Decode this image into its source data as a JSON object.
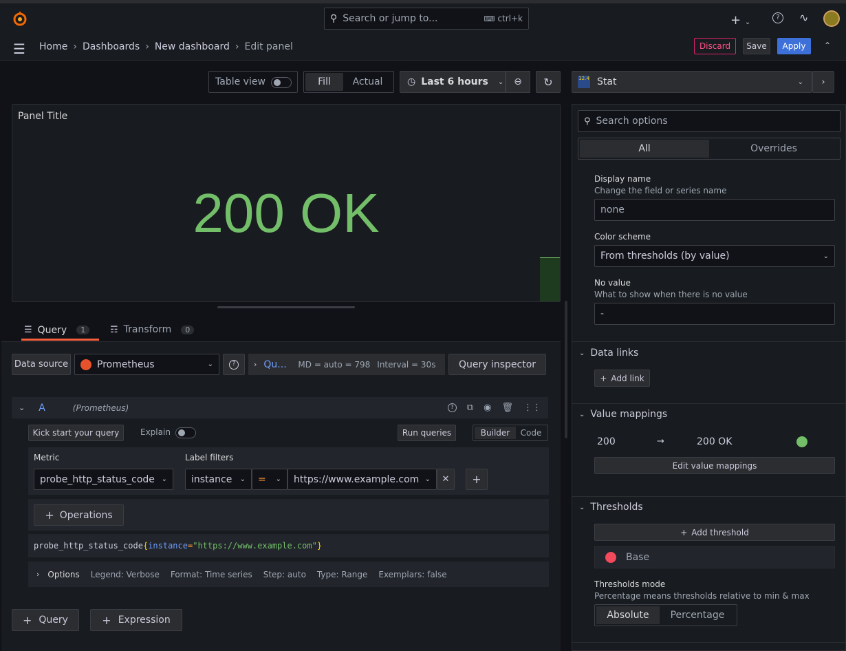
{
  "topbar": {
    "search_placeholder": "Search or jump to...",
    "shortcut": "ctrl+k"
  },
  "breadcrumb": [
    "Home",
    "Dashboards",
    "New dashboard",
    "Edit panel"
  ],
  "actions": {
    "discard": "Discard",
    "save": "Save",
    "apply": "Apply"
  },
  "toolbar": {
    "table_view": "Table view",
    "fill": "Fill",
    "actual": "Actual",
    "time_range": "Last 6 hours"
  },
  "panel": {
    "title": "Panel Title",
    "value": "200 OK",
    "value_color": "#73bf69"
  },
  "tabs": {
    "query_label": "Query",
    "query_count": "1",
    "transform_label": "Transform",
    "transform_count": "0"
  },
  "datasource": {
    "label": "Data source",
    "name": "Prometheus",
    "query_options_short": "Qu...",
    "md": "MD = auto = 798",
    "interval": "Interval = 30s",
    "inspector": "Query inspector"
  },
  "query": {
    "ref": "A",
    "ds": "(Prometheus)",
    "kickstart": "Kick start your query",
    "explain": "Explain",
    "run": "Run queries",
    "builder": "Builder",
    "code": "Code",
    "metric_label": "Metric",
    "metric_value": "probe_http_status_code",
    "label_filters_label": "Label filters",
    "label_key": "instance",
    "label_op": "=",
    "label_value": "https://www.example.com",
    "operations": "Operations",
    "expr_metric": "probe_http_status_code",
    "expr_open": "{",
    "expr_label": "instance",
    "expr_eq": "=",
    "expr_value": "\"https://www.example.com\"",
    "expr_close": "}",
    "options_label": "Options",
    "opt_legend": "Legend: Verbose",
    "opt_format": "Format: Time series",
    "opt_step": "Step: auto",
    "opt_type": "Type: Range",
    "opt_exemplars": "Exemplars: false"
  },
  "bottom": {
    "add_query": "Query",
    "add_expression": "Expression"
  },
  "viz": {
    "name": "Stat",
    "icon_badge": "12.4"
  },
  "options": {
    "search_placeholder": "Search options",
    "tab_all": "All",
    "tab_overrides": "Overrides",
    "display_name_label": "Display name",
    "display_name_desc": "Change the field or series name",
    "display_name_placeholder": "none",
    "color_scheme_label": "Color scheme",
    "color_scheme_value": "From thresholds (by value)",
    "no_value_label": "No value",
    "no_value_desc": "What to show when there is no value",
    "no_value_placeholder": "-",
    "data_links": "Data links",
    "add_link": "Add link",
    "value_mappings": "Value mappings",
    "mapping_from": "200",
    "mapping_to": "200 OK",
    "mapping_color": "#73bf69",
    "edit_mappings": "Edit value mappings",
    "thresholds": "Thresholds",
    "add_threshold": "Add threshold",
    "base": "Base",
    "base_color": "#f2495c",
    "thresholds_mode_label": "Thresholds mode",
    "thresholds_mode_desc": "Percentage means thresholds relative to min & max",
    "mode_absolute": "Absolute",
    "mode_percentage": "Percentage"
  }
}
